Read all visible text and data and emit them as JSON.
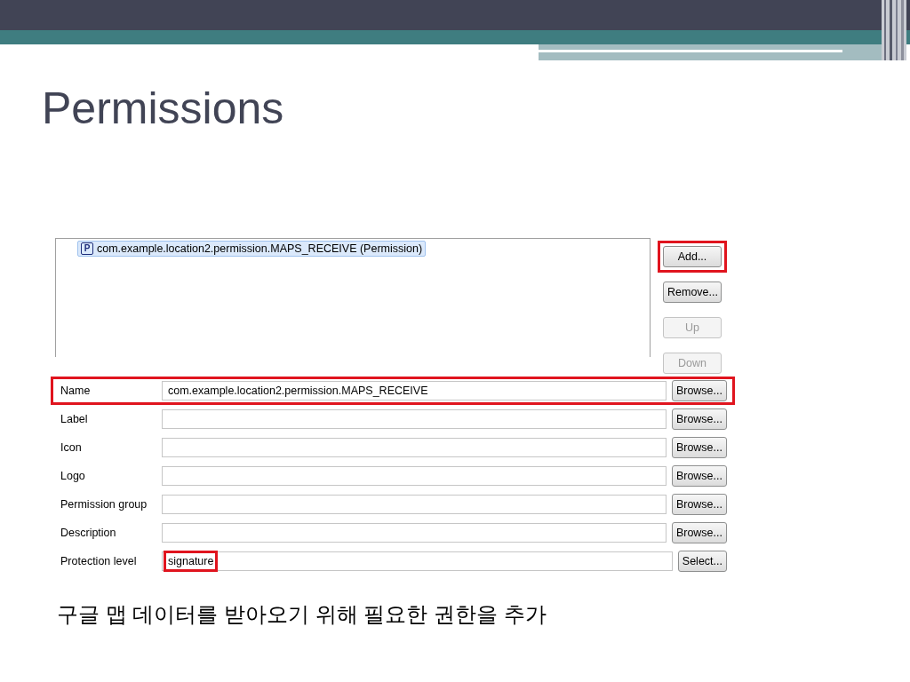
{
  "title": "Permissions",
  "permissions_list": {
    "items": [
      {
        "icon_letter": "P",
        "label": "com.example.location2.permission.MAPS_RECEIVE (Permission)",
        "selected": true
      }
    ]
  },
  "list_buttons": [
    {
      "label": "Add...",
      "disabled": false,
      "highlighted": true
    },
    {
      "label": "Remove...",
      "disabled": false,
      "highlighted": false
    },
    {
      "label": "Up",
      "disabled": true,
      "highlighted": false
    },
    {
      "label": "Down",
      "disabled": true,
      "highlighted": false
    }
  ],
  "fields": [
    {
      "label": "Name",
      "value": "com.example.location2.permission.MAPS_RECEIVE",
      "button": "Browse...",
      "row_highlighted": true
    },
    {
      "label": "Label",
      "button": "Browse...",
      "row_highlighted": false
    },
    {
      "label": "Icon",
      "button": "Browse...",
      "row_highlighted": false
    },
    {
      "label": "Logo",
      "button": "Browse...",
      "row_highlighted": false
    },
    {
      "label": "Permission group",
      "button": "Browse...",
      "row_highlighted": false
    },
    {
      "label": "Description",
      "button": "Browse...",
      "row_highlighted": false
    },
    {
      "label": "Protection level",
      "value": "signature",
      "button": "Select...",
      "row_highlighted": false,
      "value_highlighted": true
    }
  ],
  "caption": "구글 맵 데이터를 받아오기 위해 필요한 권한을 추가"
}
